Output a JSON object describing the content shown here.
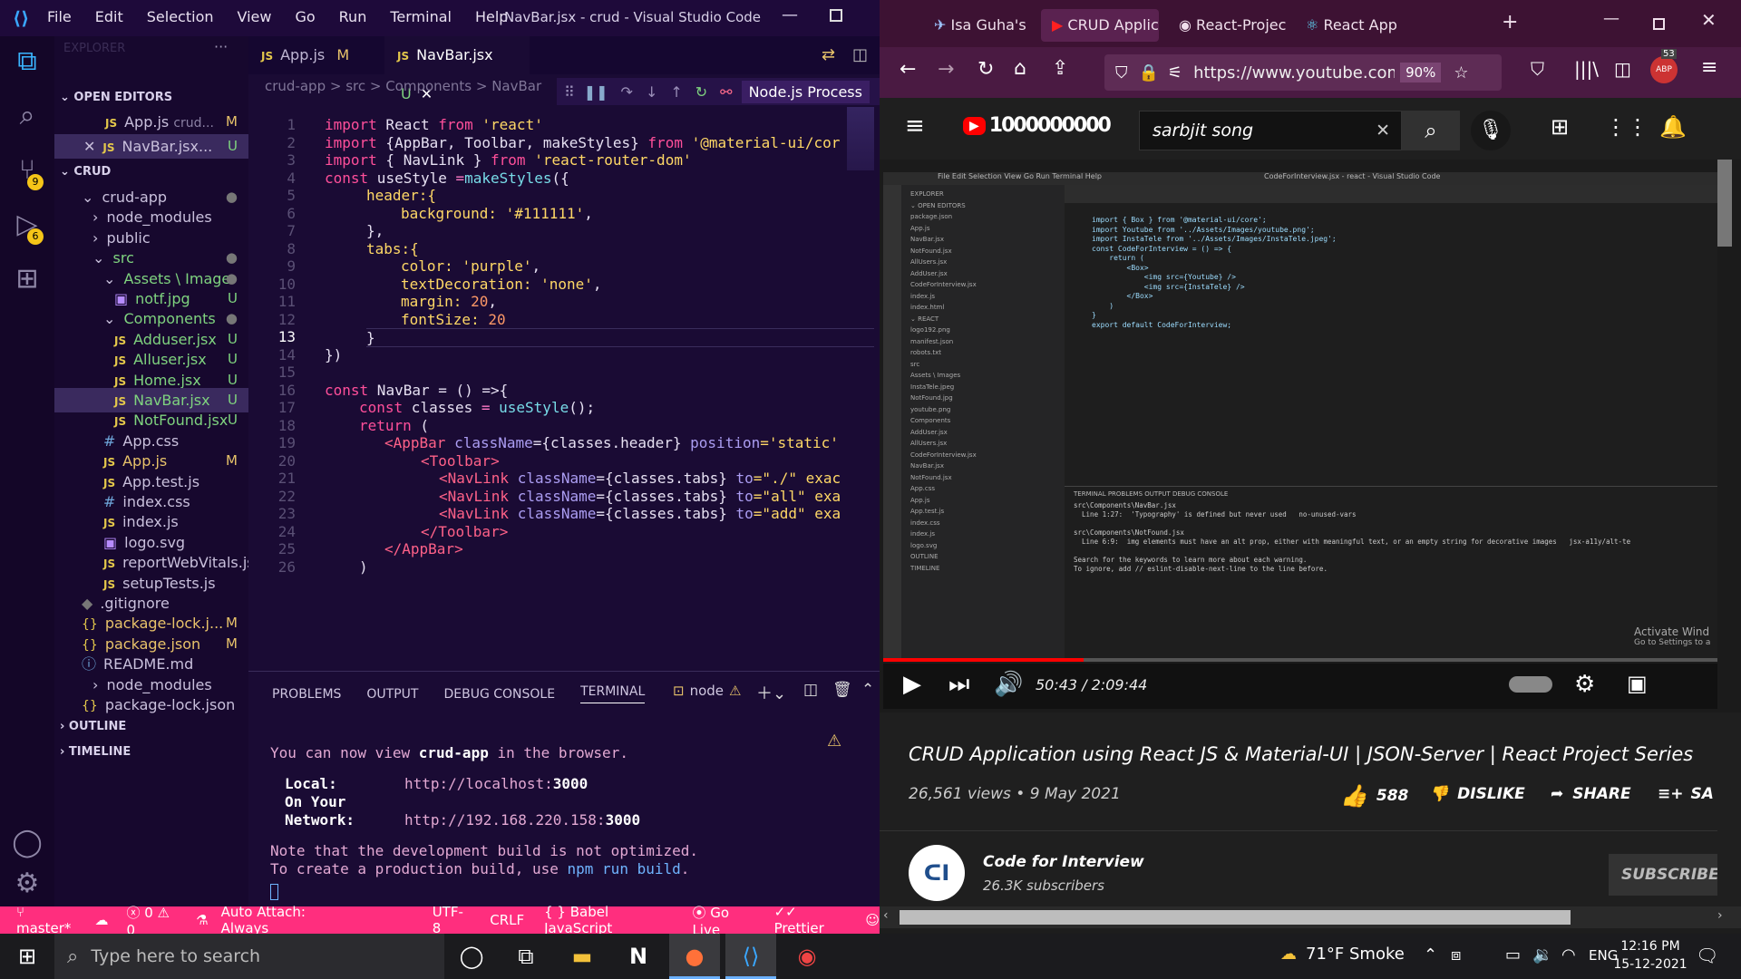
{
  "vscode": {
    "menu": [
      "File",
      "Edit",
      "Selection",
      "View",
      "Go",
      "Run",
      "Terminal",
      "Help"
    ],
    "title": "NavBar.jsx - crud - Visual Studio Code",
    "activity_badges": {
      "source_control": "9",
      "run": "6"
    },
    "sidebar": {
      "explorer_label": "EXPLORER",
      "open_editors_label": "OPEN EDITORS",
      "open_editors": [
        {
          "name": "App.js",
          "extra": "crud...",
          "status": "M"
        },
        {
          "name": "NavBar.jsx...",
          "extra": "",
          "status": "U"
        }
      ],
      "crud_label": "CRUD",
      "tree": [
        {
          "name": "crud-app",
          "kind": "folder",
          "status": "●"
        },
        {
          "name": "node_modules",
          "kind": "folder-closed",
          "status": ""
        },
        {
          "name": "public",
          "kind": "folder-closed",
          "status": ""
        },
        {
          "name": "src",
          "kind": "folder",
          "status": "●"
        },
        {
          "name": "Assets \\ Image",
          "kind": "folder",
          "status": "●"
        },
        {
          "name": "notf.jpg",
          "kind": "image",
          "status": "U"
        },
        {
          "name": "Components",
          "kind": "folder",
          "status": "●"
        },
        {
          "name": "Adduser.jsx",
          "kind": "js",
          "status": "U"
        },
        {
          "name": "Alluser.jsx",
          "kind": "js",
          "status": "U"
        },
        {
          "name": "Home.jsx",
          "kind": "js",
          "status": "U"
        },
        {
          "name": "NavBar.jsx",
          "kind": "js",
          "status": "U"
        },
        {
          "name": "NotFound.jsx",
          "kind": "js",
          "status": "U"
        },
        {
          "name": "App.css",
          "kind": "css",
          "status": ""
        },
        {
          "name": "App.js",
          "kind": "js",
          "status": "M"
        },
        {
          "name": "App.test.js",
          "kind": "js",
          "status": ""
        },
        {
          "name": "index.css",
          "kind": "css",
          "status": ""
        },
        {
          "name": "index.js",
          "kind": "js",
          "status": ""
        },
        {
          "name": "logo.svg",
          "kind": "image",
          "status": ""
        },
        {
          "name": "reportWebVitals.js",
          "kind": "js",
          "status": ""
        },
        {
          "name": "setupTests.js",
          "kind": "js",
          "status": ""
        },
        {
          "name": ".gitignore",
          "kind": "git",
          "status": ""
        },
        {
          "name": "package-lock.j...",
          "kind": "json",
          "status": "M"
        },
        {
          "name": "package.json",
          "kind": "json",
          "status": "M"
        },
        {
          "name": "README.md",
          "kind": "info",
          "status": ""
        },
        {
          "name": "node_modules",
          "kind": "folder-closed",
          "status": ""
        },
        {
          "name": "package-lock.json",
          "kind": "json",
          "status": ""
        }
      ],
      "outline_label": "OUTLINE",
      "timeline_label": "TIMELINE"
    },
    "tabs": [
      {
        "name": "App.js",
        "status": "M"
      },
      {
        "name": "NavBar.jsx",
        "status": "U"
      }
    ],
    "breadcrumb": "crud-app > src > Components > NavBar",
    "debug_label": "Node.js Process",
    "code_lines": [
      "1",
      "2",
      "3",
      "4",
      "5",
      "6",
      "7",
      "8",
      "9",
      "10",
      "11",
      "12",
      "13",
      "14",
      "15",
      "16",
      "17",
      "18",
      "19",
      "20",
      "21",
      "22",
      "23",
      "24",
      "25",
      "26"
    ],
    "code": {
      "l1a": "import",
      "l1b": " React ",
      "l1c": "from",
      "l1d": " 'react'",
      "l2a": "import",
      "l2b": " {AppBar, Toolbar, makeStyles} ",
      "l2c": "from",
      "l2d": " '@material-ui/cor",
      "l3a": "import",
      "l3b": " { NavLink } ",
      "l3c": "from",
      "l3d": " 'react-router-dom'",
      "l4a": "const",
      "l4b": " useStyle ",
      "l4c": "=",
      "l4d": "makeStyles",
      "l4e": "({",
      "l5": "header:{",
      "l6a": "background: ",
      "l6b": "'#111111'",
      "l6c": ",",
      "l7": "},",
      "l8": "tabs:{",
      "l9a": "color: ",
      "l9b": "'purple'",
      "l9c": ",",
      "l10a": "textDecoration: ",
      "l10b": "'none'",
      "l10c": ",",
      "l11a": "margin: ",
      "l11b": "20",
      "l11c": ",",
      "l12a": "fontSize: ",
      "l12b": "20",
      "l13": "}",
      "l14": "})",
      "l16a": "const",
      "l16b": " NavBar ",
      "l16c": "= () =>{",
      "l17a": "const",
      "l17b": " classes ",
      "l17c": "= ",
      "l17d": "useStyle",
      "l17e": "();",
      "l18a": "return",
      "l18b": " (",
      "l19a": "<AppBar ",
      "l19b": "className",
      "l19c": "={classes.header} ",
      "l19d": "position",
      "l19e": "='static'",
      "l20": "<Toolbar>",
      "l21a": "<NavLink ",
      "l21b": "className",
      "l21c": "={classes.tabs} ",
      "l21d": "to",
      "l21e": "=\"./\" exac",
      "l22a": "<NavLink ",
      "l22b": "className",
      "l22c": "={classes.tabs} ",
      "l22d": "to",
      "l22e": "=\"all\" exa",
      "l23a": "<NavLink ",
      "l23b": "className",
      "l23c": "={classes.tabs} ",
      "l23d": "to",
      "l23e": "=\"add\" exa",
      "l24": "</Toolbar>",
      "l25": "</AppBar>",
      "l26": ")"
    },
    "panel": {
      "tabs": [
        "PROBLEMS",
        "OUTPUT",
        "DEBUG CONSOLE",
        "TERMINAL"
      ],
      "node_label": "node",
      "t1a": "You can now view ",
      "t1b": "crud-app",
      "t1c": " in the browser.",
      "t2a": "Local:",
      "t2b": "http://localhost:",
      "t2c": "3000",
      "t3a": "On Your Network:",
      "t3b": "http://192.168.220.158:",
      "t3c": "3000",
      "t4": "Note that the development build is not optimized.",
      "t5a": "To create a production build, use ",
      "t5b": "npm run build",
      "t5c": "."
    },
    "status": {
      "branch": "master*",
      "errors": "0",
      "warnings": "0",
      "auto_attach": "Auto Attach: Always",
      "encoding": "UTF-8",
      "eol": "CRLF",
      "language": "Babel JavaScript",
      "golive": "Go Live",
      "prettier": "Prettier"
    }
  },
  "firefox": {
    "tabs": [
      {
        "title": "Isa Guha's 'dou"
      },
      {
        "title": "CRUD Applic"
      },
      {
        "title": "React-Projects/"
      },
      {
        "title": "React App"
      }
    ],
    "url": "https://www.youtube.com/wat",
    "zoom": "90%",
    "ext_badge": "53",
    "ext_badge_sub": "ABP",
    "youtube": {
      "logo_text": "1000000000",
      "search_value": "sarbjit song",
      "time": "50:43 / 2:09:44",
      "video_title": "CRUD Application using React JS & Material-UI | JSON-Server | React Project Series",
      "views": "26,561 views • 9 May 2021",
      "likes": "588",
      "dislike": "DISLIKE",
      "share": "SHARE",
      "save": "SA",
      "channel": "Code for Interview",
      "subs": "26.3K subscribers",
      "subscribe": "SUBSCRIBE",
      "activate": "Activate Wind",
      "activate2": "Go to Settings to a",
      "inner_title": "CodeForInterview.jsx - react - Visual Studio Code",
      "inner_code": [
        "import { Box } from '@material-ui/core';",
        "import Youtube from '../Assets/Images/youtube.png';",
        "import InstaTele from '../Assets/Images/InstaTele.jpeg';",
        "",
        "const CodeForInterview = () => {",
        "    return (",
        "        <Box>",
        "            <img src={Youtube} />",
        "            <img src={InstaTele} />",
        "        </Box>",
        "    )",
        "}",
        "",
        "export default CodeForInterview;"
      ],
      "inner_term": [
        "src\\Components\\NavBar.jsx",
        "  Line 1:27:  'Typography' is defined but never used   no-unused-vars",
        "",
        "src\\Components\\NotFound.jsx",
        "  Line 6:9:  img elements must have an alt prop, either with meaningful text, or an empty string for decorative images   jsx-a11y/alt-te",
        "",
        "Search for the keywords to learn more about each warning.",
        "To ignore, add // eslint-disable-next-line to the line before."
      ]
    }
  },
  "taskbar": {
    "search_placeholder": "Type here to search",
    "weather": "71°F  Smoke",
    "lang": "ENG",
    "time": "12:16 PM",
    "date": "15-12-2021"
  }
}
